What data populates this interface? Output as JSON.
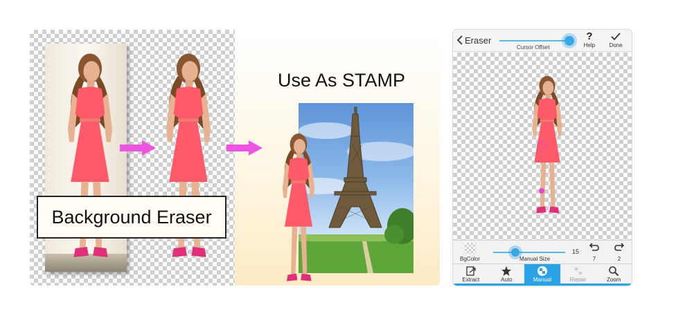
{
  "promo": {
    "eraser_label": "Background Eraser",
    "stamp_title": "Use As STAMP"
  },
  "app": {
    "header": {
      "back_icon": "chevron-left-icon",
      "title": "Eraser",
      "cursor_offset_label": "Cursor Offset",
      "help_glyph": "?",
      "help_label": "Help",
      "done_label": "Done"
    },
    "controls": {
      "bgcolor_label": "BgColor",
      "manual_size_label": "Manual Size",
      "manual_size_value": "15",
      "undo_count": "7",
      "redo_count": "2"
    },
    "tabs": [
      {
        "label": "Extract",
        "icon": "extract-icon"
      },
      {
        "label": "Auto",
        "icon": "star-icon"
      },
      {
        "label": "Manual",
        "icon": "manual-eraser-icon",
        "active": true
      },
      {
        "label": "Repair",
        "icon": "repair-icon"
      },
      {
        "label": "Zoom",
        "icon": "zoom-icon"
      }
    ],
    "colors": {
      "accent": "#2aa3e6",
      "dress": "#ff5a6a",
      "shoes": "#e0307a",
      "arrow": "#ee55e0"
    }
  }
}
